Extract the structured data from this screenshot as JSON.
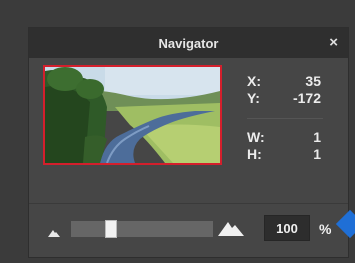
{
  "panel": {
    "title": "Navigator",
    "close_glyph": "×"
  },
  "preview": {
    "description_icon": "landscape-thumbnail",
    "highlight_color": "#d41f2c"
  },
  "readout": {
    "x_label": "X:",
    "x_value": "35",
    "y_label": "Y:",
    "y_value": "-172",
    "w_label": "W:",
    "w_value": "1",
    "h_label": "H:",
    "h_value": "1"
  },
  "zoom": {
    "value": "100",
    "unit": "%",
    "slider_fraction": 0.26,
    "zoom_out_icon": "zoom-out-mountain-icon",
    "zoom_in_icon": "zoom-in-mountain-icon"
  },
  "colors": {
    "accent": "#1f6fd6",
    "panel_bg": "#464646",
    "titlebar_bg": "#2f2f2f"
  }
}
